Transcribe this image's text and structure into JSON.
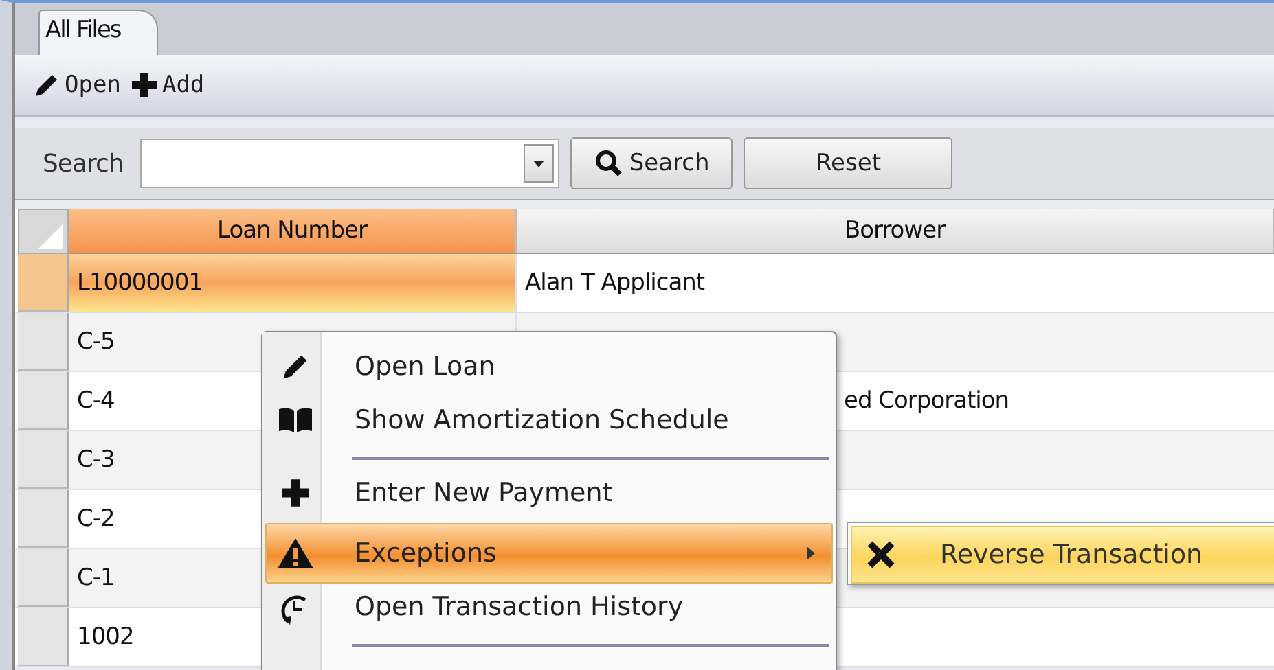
{
  "tabs": [
    {
      "label": "All Files",
      "selected": true
    }
  ],
  "toolbar": [
    {
      "label": "Open",
      "kind": "edit"
    },
    {
      "label": "Add",
      "kind": "add"
    }
  ],
  "search": {
    "label": "Search",
    "button": "Search",
    "reset": "Reset"
  },
  "table": {
    "columns": [
      {
        "label": "Loan Number",
        "selected": true
      },
      {
        "label": "Borrower",
        "selected": false
      }
    ],
    "rows": [
      {
        "cells": [
          "L10000001",
          "Alan T Applicant"
        ],
        "selected": true
      },
      {
        "cells": [
          "C-5",
          ""
        ],
        "selected": false
      },
      {
        "cells": [
          "C-4",
          "ed Corporation"
        ],
        "selected": false
      },
      {
        "cells": [
          "C-3",
          ""
        ],
        "selected": false
      },
      {
        "cells": [
          "C-2",
          ""
        ],
        "selected": false
      },
      {
        "cells": [
          "C-1",
          ""
        ],
        "selected": false
      },
      {
        "cells": [
          "1002",
          ""
        ],
        "selected": false
      }
    ]
  },
  "context_menu": {
    "items": [
      {
        "label": "Open Loan",
        "selected": false,
        "separator_after": false,
        "submenu": false
      },
      {
        "label": "Show Amortization Schedule",
        "selected": false,
        "separator_after": true,
        "submenu": false
      },
      {
        "label": "Enter New Payment",
        "selected": false,
        "separator_after": false,
        "submenu": false
      },
      {
        "label": "Exceptions",
        "selected": true,
        "separator_after": false,
        "submenu": true
      },
      {
        "label": "Open Transaction History",
        "selected": false,
        "separator_after": true,
        "submenu": false
      }
    ],
    "submenu": [
      {
        "label": "Reverse Transaction",
        "selected": true
      }
    ]
  }
}
